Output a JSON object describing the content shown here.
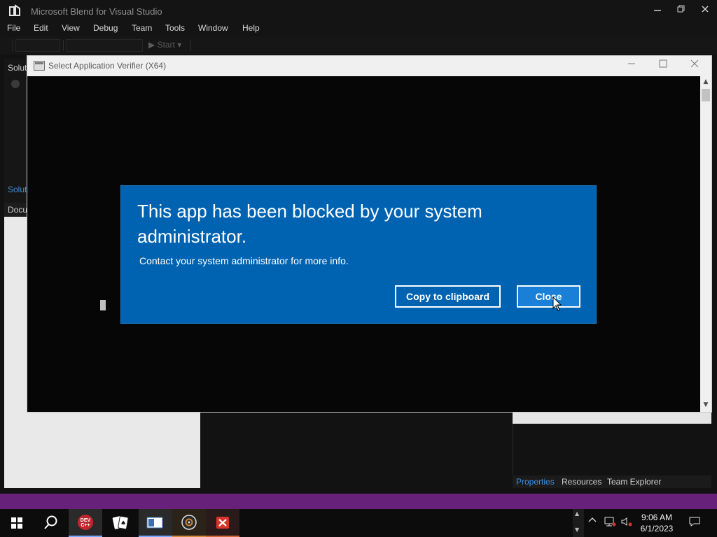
{
  "app": {
    "title": "Microsoft Blend for Visual Studio",
    "menu": [
      "File",
      "Edit",
      "View",
      "Debug",
      "Team",
      "Tools",
      "Window",
      "Help"
    ],
    "toolbar_start": "Start"
  },
  "panels": {
    "solution_tab_top": "Solut",
    "solution_tab_active": "Solut",
    "documents_tab": "Docu",
    "right_tabs": [
      "Properties",
      "Resources",
      "Team Explorer"
    ]
  },
  "verifier": {
    "title": "Select Application Verifier (X64)"
  },
  "dialog": {
    "title": "This app has been blocked by your system administrator.",
    "message": "Contact your system administrator for more info.",
    "copy_label": "Copy to clipboard",
    "close_label": "Close",
    "bg_color": "#0063b1"
  },
  "taskbar": {
    "time": "9:06 AM",
    "date": "6/1/2023",
    "pinned": [
      "start-icon",
      "search-icon",
      "devcpp-icon",
      "solitaire-icon",
      "blend-icon",
      "media-player-icon",
      "blocked-app-icon"
    ],
    "devcpp_label": "DEV C++"
  },
  "colors": {
    "accent": "#0078d7",
    "status_bar": "#68217a"
  }
}
